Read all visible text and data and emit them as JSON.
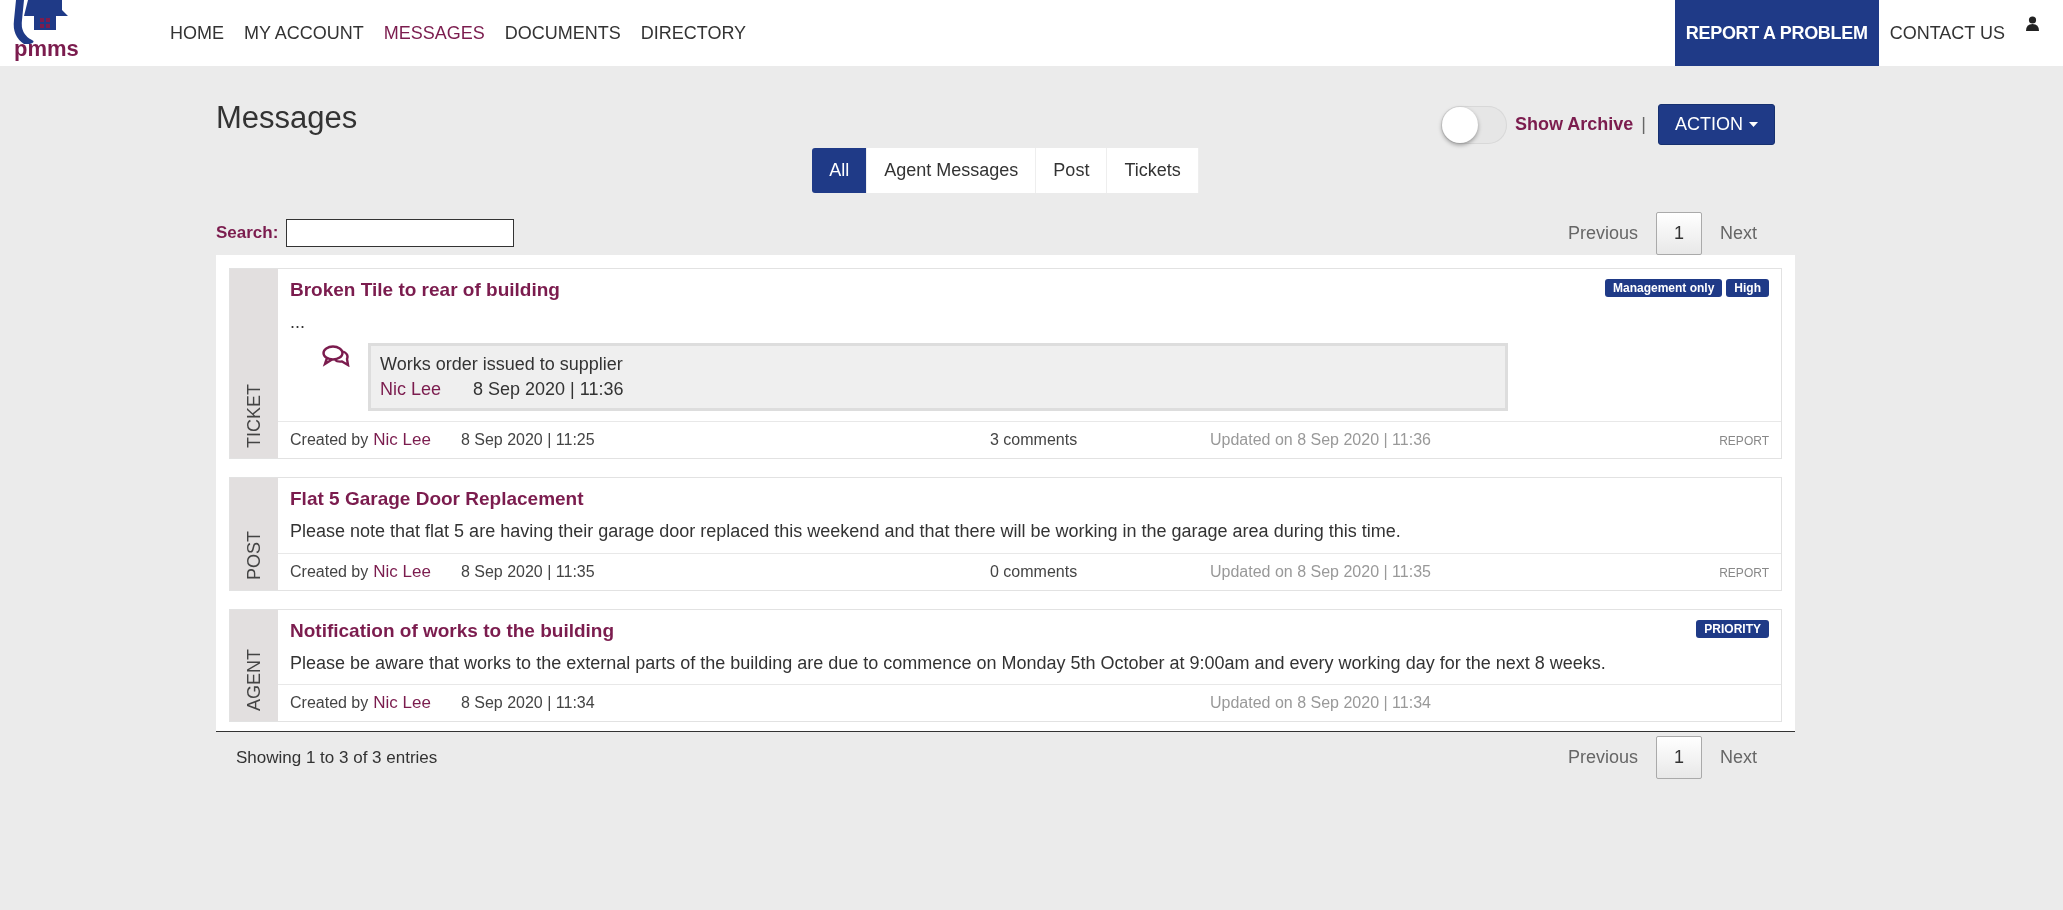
{
  "nav": {
    "logo": "pmms",
    "items": [
      {
        "label": "HOME",
        "selected": false
      },
      {
        "label": "MY ACCOUNT",
        "selected": false
      },
      {
        "label": "MESSAGES",
        "selected": true
      },
      {
        "label": "DOCUMENTS",
        "selected": false
      },
      {
        "label": "DIRECTORY",
        "selected": false
      }
    ],
    "report_button": "REPORT A PROBLEM",
    "contact_link": "CONTACT US"
  },
  "page": {
    "title": "Messages",
    "archive": {
      "label": "Show Archive",
      "on": false,
      "separator": "|"
    },
    "action_button": "ACTION",
    "filter_tabs": [
      {
        "label": "All",
        "selected": true
      },
      {
        "label": "Agent Messages",
        "selected": false
      },
      {
        "label": "Post",
        "selected": false
      },
      {
        "label": "Tickets",
        "selected": false
      }
    ],
    "search": {
      "label": "Search:"
    },
    "pagination": {
      "previous": "Previous",
      "pages": [
        {
          "label": "1",
          "selected": true
        }
      ],
      "next": "Next"
    }
  },
  "messages": [
    {
      "type": "TICKET",
      "title": "Broken Tile to rear of building",
      "badges": [
        "Management only",
        "High"
      ],
      "body": "...",
      "comment": {
        "text": "Works order issued to supplier",
        "author": "Nic Lee",
        "time": "8 Sep 2020 | 11:36"
      },
      "created_label": "Created by",
      "author": "Nic Lee",
      "created": "8 Sep 2020 | 11:25",
      "comments": "3 comments",
      "updated": "Updated on 8 Sep 2020 | 11:36",
      "report": "REPORT"
    },
    {
      "type": "POST",
      "title": "Flat 5 Garage Door Replacement",
      "body": "Please note that flat 5 are having their garage door replaced this weekend and that there will be working in the garage area during this time.",
      "created_label": "Created by",
      "author": "Nic Lee",
      "created": "8 Sep 2020 | 11:35",
      "comments": "0 comments",
      "updated": "Updated on 8 Sep 2020 | 11:35",
      "report": "REPORT"
    },
    {
      "type": "AGENT",
      "title": "Notification of works to the building",
      "badges": [
        "PRIORITY"
      ],
      "body": "Please be aware that works to the external parts of the building are due to commence on Monday 5th October at 9:00am and every working day for the next 8 weeks.",
      "created_label": "Created by",
      "author": "Nic Lee",
      "created": "8 Sep 2020 | 11:34",
      "updated": "Updated on 8 Sep 2020 | 11:34"
    }
  ],
  "footer": {
    "info": "Showing 1 to 3 of 3 entries",
    "pagination": {
      "previous": "Previous",
      "pages": [
        {
          "label": "1",
          "selected": true
        }
      ],
      "next": "Next"
    }
  }
}
